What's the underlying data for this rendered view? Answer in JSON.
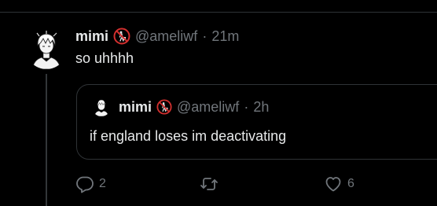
{
  "tweet": {
    "display_name": "mimi",
    "handle": "@ameliwf",
    "separator": "·",
    "time": "21m",
    "text": "so uhhhh"
  },
  "quoted": {
    "display_name": "mimi",
    "handle": "@ameliwf",
    "separator": "·",
    "time": "2h",
    "text": "if england loses im deactivating"
  },
  "actions": {
    "reply_count": "2",
    "retweet_count": "",
    "like_count": "6"
  },
  "colors": {
    "background": "#000000",
    "text": "#e7e9ea",
    "muted": "#71767b",
    "border": "#2f3336",
    "badge_red": "#d3302f"
  },
  "icons": {
    "badge": "no-littering-icon",
    "reply": "reply-icon",
    "retweet": "retweet-icon",
    "like": "heart-icon"
  }
}
